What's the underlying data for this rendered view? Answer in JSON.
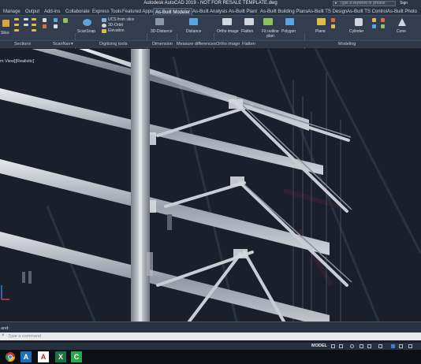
{
  "window": {
    "title": "Autodesk AutoCAD 2019 - NOT FOR RESALE   TEMPLATE.dwg",
    "search_placeholder": "Type a keyword or phrase",
    "signin": "Sign"
  },
  "tabs": [
    {
      "label": "Manage",
      "active": false
    },
    {
      "label": "Output",
      "active": false
    },
    {
      "label": "Add-ins",
      "active": false
    },
    {
      "label": "Collaborate",
      "active": false
    },
    {
      "label": "Express Tools",
      "active": false
    },
    {
      "label": "Featured Apps",
      "active": false
    },
    {
      "label": "As-Built Modeler",
      "active": true
    },
    {
      "label": "As-Built Analysis",
      "active": false
    },
    {
      "label": "As-Built Plant",
      "active": false
    },
    {
      "label": "As-Built Building Plans",
      "active": false
    },
    {
      "label": "As-Built TS Design",
      "active": false
    },
    {
      "label": "As-Built TS Control",
      "active": false
    },
    {
      "label": "As-Built Photo",
      "active": false
    }
  ],
  "ribbon": {
    "tools": {
      "slice": "Slice",
      "scannav": "ScanNav",
      "ucs_from_slice": "UCS from slice",
      "orbit_3d": "3D-Orbit",
      "elevation": "Elevation",
      "distance_3d": "3D-Distance",
      "distance": "Distance",
      "ortho_image": "Ortho image",
      "flatten": "Flatten",
      "fit_outline_plan": "Fit outline plan",
      "polygon": "Polygon",
      "plane": "Plane",
      "cylinder": "Cylinder",
      "cone": "Cone"
    },
    "panels": {
      "sections": "Sections",
      "scannav": "ScanNav",
      "digitizing": "Digitizing tools",
      "dimension": "Dimension",
      "measure": "Measure differences",
      "ortho": "Ortho image",
      "flatten": "Flatten",
      "modeling": "Modeling"
    }
  },
  "viewport": {
    "label": "m View][Realistic]"
  },
  "command": {
    "history": "and:",
    "placeholder": "Type a command"
  },
  "status": {
    "model": "MODEL"
  },
  "taskbar": {
    "apps": [
      {
        "name": "chrome",
        "glyph": "",
        "color": "#d93025"
      },
      {
        "name": "autocad-a",
        "glyph": "A",
        "color": "#1e6fb8"
      },
      {
        "name": "autocad-red",
        "glyph": "A",
        "color": "#c0242b"
      },
      {
        "name": "excel",
        "glyph": "X",
        "color": "#1d7245"
      },
      {
        "name": "camtasia",
        "glyph": "C",
        "color": "#2aa84a"
      }
    ]
  }
}
